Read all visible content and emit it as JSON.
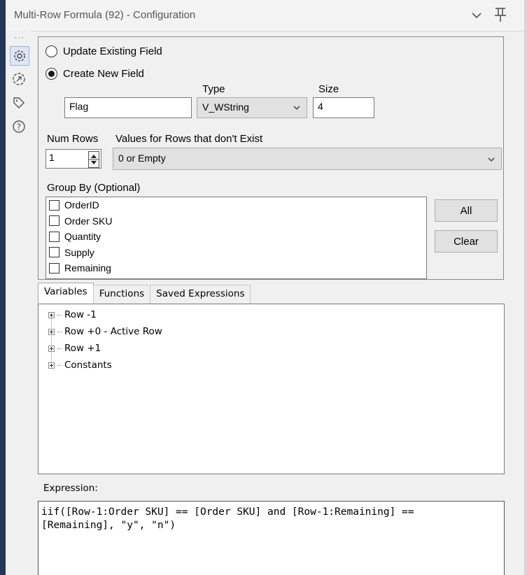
{
  "window": {
    "title": "Multi-Row Formula (92) - Configuration"
  },
  "toolbar_icons": [
    "gear-icon",
    "output-anchor-icon",
    "tag-icon",
    "help-icon"
  ],
  "field_mode": {
    "update_label": "Update Existing Field",
    "create_label": "Create New  Field",
    "selected": "create"
  },
  "new_field": {
    "name": "Flag",
    "type_label": "Type",
    "type_value": "V_WString",
    "size_label": "Size",
    "size_value": "4"
  },
  "rows": {
    "num_rows_label": "Num Rows",
    "num_rows_value": "1",
    "missing_label": "Values for Rows that don't Exist",
    "missing_value": "0 or Empty"
  },
  "group_by": {
    "label": "Group By (Optional)",
    "items": [
      "OrderID",
      "Order SKU",
      "Quantity",
      "Supply",
      "Remaining"
    ],
    "all_button": "All",
    "clear_button": "Clear"
  },
  "tabs": [
    "Variables",
    "Functions",
    "Saved Expressions"
  ],
  "active_tab": "Variables",
  "variables_tree": [
    "Row -1",
    "Row +0 - Active Row",
    "Row +1",
    "Constants"
  ],
  "expression": {
    "label": "Expression:",
    "text": "iif([Row-1:Order SKU] == [Order SKU] and [Row-1:Remaining] ==\n[Remaining], \"y\", \"n\")"
  }
}
